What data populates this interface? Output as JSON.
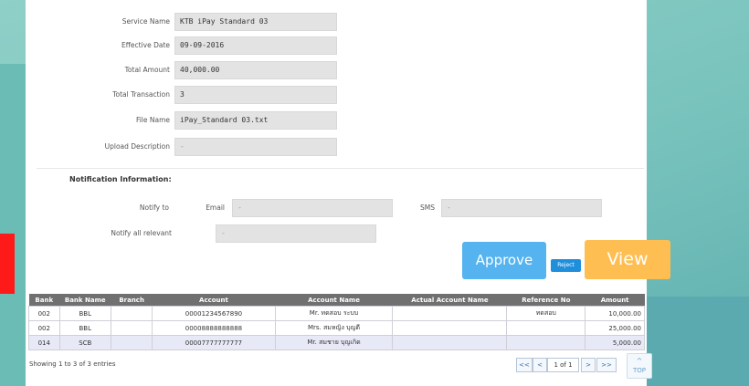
{
  "form": {
    "service_name_label": "Service Name",
    "service_name": "KTB iPay Standard 03",
    "effective_date_label": "Effective Date",
    "effective_date": "09-09-2016",
    "total_amount_label": "Total Amount",
    "total_amount": "40,000.00",
    "total_transaction_label": "Total Transaction",
    "total_transaction": "3",
    "file_name_label": "File Name",
    "file_name": "iPay_Standard 03.txt",
    "upload_description_label": "Upload Description",
    "upload_description": "-"
  },
  "notification": {
    "title": "Notification Information:",
    "notify_to_label": "Notify to",
    "email_label": "Email",
    "email_value": "-",
    "sms_label": "SMS",
    "sms_value": "-",
    "notify_all_label": "Notify all relevant",
    "notify_all_value": "-"
  },
  "actions": {
    "approve_label": "Approve",
    "reject_label": "Reject",
    "view_label": "View"
  },
  "table": {
    "columns": [
      "Bank",
      "Bank Name",
      "Branch",
      "Account",
      "Account Name",
      "Actual Account Name",
      "Reference No",
      "Amount"
    ],
    "rows": [
      [
        "002",
        "BBL",
        "",
        "00001234567890",
        "Mr. ทดสอบ ระบบ",
        "",
        "ทดสอบ",
        "10,000.00"
      ],
      [
        "002",
        "BBL",
        "",
        "00008888888888",
        "Mrs. สมหญิง บุญดี",
        "",
        "",
        "25,000.00"
      ],
      [
        "014",
        "SCB",
        "",
        "00007777777777",
        "Mr. สมชาย บุญเกิด",
        "",
        "",
        "5,000.00"
      ]
    ]
  },
  "footer": {
    "info": "Showing 1 to 3 of 3 entries",
    "first": "<<",
    "prev": "<",
    "page": "1 of 1",
    "next": ">",
    "last": ">>",
    "top_arrow": "^",
    "top_label": "TOP"
  },
  "colors": {
    "approve": "#55b3f0",
    "reject": "#1f8fdc",
    "view": "#ffbe52",
    "table_header": "#707070",
    "alert_block": "#ff1a1a"
  }
}
